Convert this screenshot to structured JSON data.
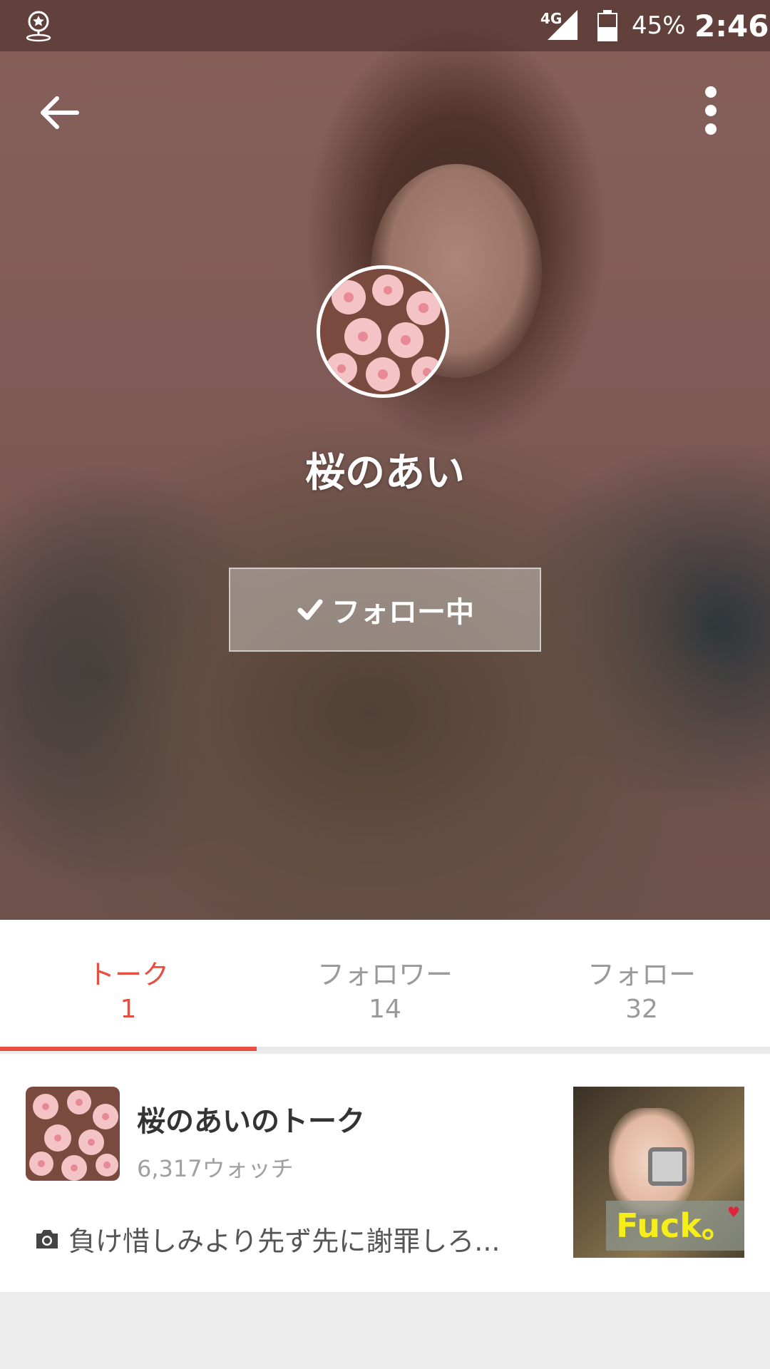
{
  "status_bar": {
    "network": "4G",
    "battery": "45%",
    "time": "2:46"
  },
  "hero": {
    "name": "桜のあい",
    "follow_button": "フォロー中"
  },
  "tabs": [
    {
      "label": "トーク",
      "count": "1",
      "active": true
    },
    {
      "label": "フォロワー",
      "count": "14",
      "active": false
    },
    {
      "label": "フォロー",
      "count": "32",
      "active": false
    }
  ],
  "talk_card": {
    "title": "桜のあいのトーク",
    "watch_count": "6,317ウォッチ",
    "snippet": "負け惜しみより先ず先に謝罪しろ...",
    "photo_caption": "Fuck。"
  },
  "colors": {
    "accent": "#e84d3d",
    "background": "#ececec"
  },
  "icons": [
    "location-pin-icon",
    "signal-icon",
    "battery-icon",
    "back-arrow-icon",
    "more-vert-icon",
    "check-icon",
    "camera-icon"
  ]
}
